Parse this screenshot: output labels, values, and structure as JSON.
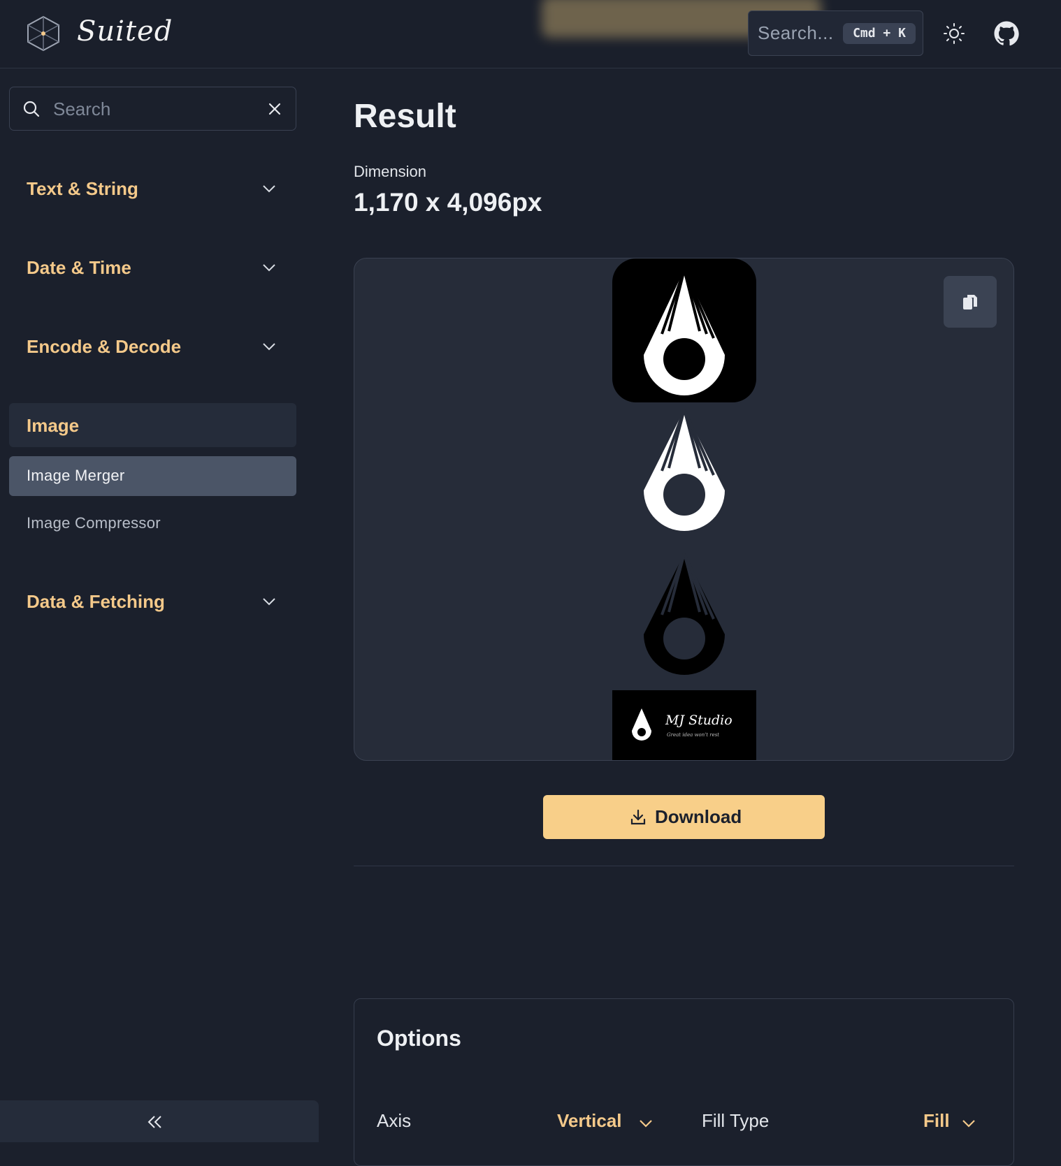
{
  "header": {
    "brand": "Suited",
    "search_placeholder": "Search...",
    "search_shortcut": "Cmd + K"
  },
  "sidebar": {
    "search_placeholder": "Search",
    "categories": [
      {
        "label": "Text & String"
      },
      {
        "label": "Date & Time"
      },
      {
        "label": "Encode & Decode"
      },
      {
        "label": "Image"
      },
      {
        "label": "Data & Fetching"
      }
    ],
    "image_items": [
      {
        "label": "Image Merger",
        "selected": true
      },
      {
        "label": "Image Compressor",
        "selected": false
      }
    ]
  },
  "main": {
    "title": "Result",
    "dimension_label": "Dimension",
    "dimension_value": "1,170 x 4,096px",
    "preview_footer": {
      "brand": "MJ Studio",
      "tagline": "Great idea won't rest"
    },
    "download_label": "Download",
    "options": {
      "title": "Options",
      "axis_label": "Axis",
      "axis_value": "Vertical",
      "fill_type_label": "Fill Type",
      "fill_type_value": "Fill"
    }
  },
  "colors": {
    "accent": "#f4c98a",
    "button": "#f8cf89",
    "background": "#1b202c",
    "selected_item": "#4b5567"
  },
  "icons": [
    "cube-logo-icon",
    "sun-icon",
    "github-icon",
    "search-icon",
    "close-icon",
    "chevron-down-icon",
    "copy-icon",
    "download-icon",
    "double-chevron-left-icon"
  ]
}
